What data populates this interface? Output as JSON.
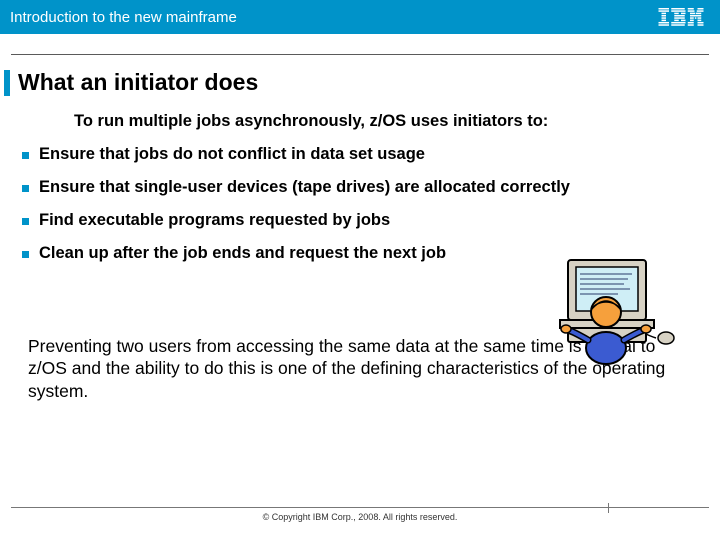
{
  "header": {
    "title": "Introduction to the new mainframe",
    "logo": "IBM"
  },
  "slide": {
    "title": "What an initiator does",
    "subtitle": "To run multiple jobs asynchronously, z/OS  uses initiators to:",
    "bullets": [
      "Ensure that jobs do not conflict in data set usage",
      "Ensure that single-user devices (tape drives) are allocated correctly",
      "Find executable programs requested by jobs",
      "Clean up after the job ends and request the next job"
    ],
    "callout": "Preventing two users from accessing the same data at the same time is critical to z/OS and the ability to do this is one of the defining characteristics of the operating system."
  },
  "footer": {
    "copyright": "© Copyright IBM Corp., 2008. All rights reserved."
  }
}
